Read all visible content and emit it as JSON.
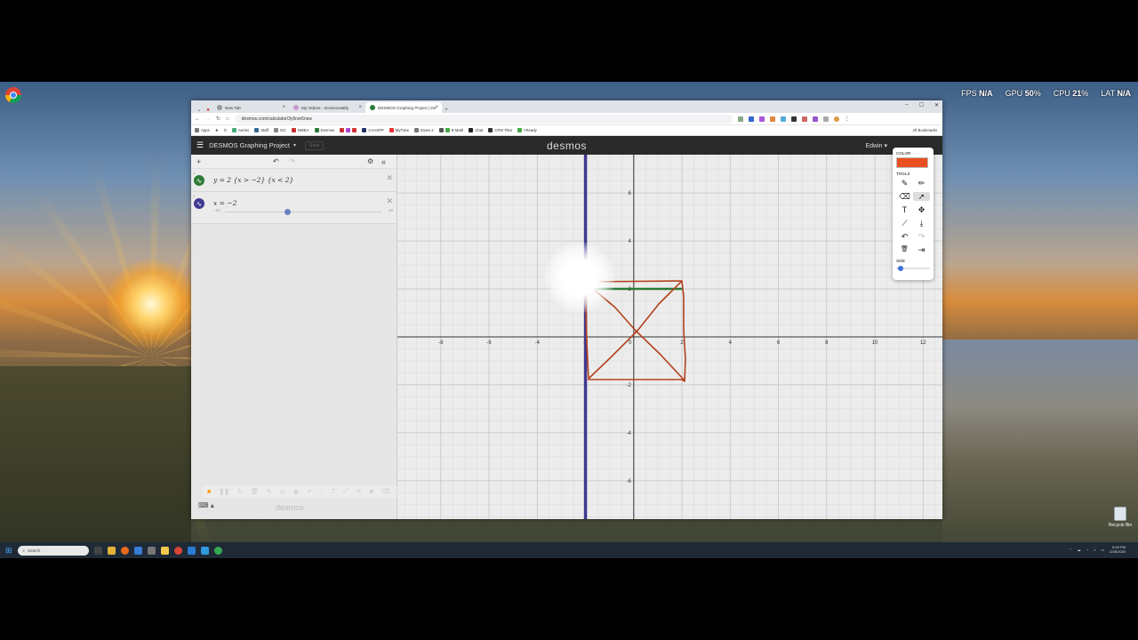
{
  "overlay": {
    "fps_label": "FPS",
    "fps_value": "N/A",
    "gpu_label": "GPU",
    "gpu_value": "50",
    "cpu_label": "CPU",
    "cpu_value": "21",
    "lat_label": "LAT",
    "lat_value": "N/A"
  },
  "desktop": {
    "recycle_bin": "Recycle Bin"
  },
  "browser": {
    "tabs": [
      {
        "label": "New Tab"
      },
      {
        "label": "My Videos - Screencastify"
      },
      {
        "label": "DESMOS Graphing Project | De"
      }
    ],
    "url": "desmos.com/calculator/3y5rze5nsw",
    "bookmarks": [
      "Apps",
      "G",
      "Aeries",
      "Staff",
      "GG",
      "NWEA",
      "Desmos",
      "CAASPP",
      "MyTube",
      "Exam 2",
      "B Math",
      "Chat",
      "CPM Tiles",
      "i-Ready"
    ],
    "all_bookmarks": "All Bookmarks"
  },
  "desmos": {
    "title": "DESMOS Graphing Project",
    "save_label": "Save",
    "logo": "desmos",
    "user": "Edwin",
    "expressions": [
      {
        "num": "1",
        "latex": "y = 2 {x > −2} {x < 2}",
        "color": "#2d7a37"
      },
      {
        "num": "2",
        "latex": "x = −2",
        "color": "#3f3891"
      }
    ],
    "slider": {
      "min": "−10",
      "max": "10",
      "value": -2
    },
    "watermark": "desmos"
  },
  "graph": {
    "x_ticks": [
      "-8",
      "-6",
      "-4",
      "-2",
      "0",
      "2",
      "4",
      "6",
      "8",
      "10",
      "12"
    ],
    "y_ticks": [
      "6",
      "4",
      "2",
      "-2",
      "-4",
      "-6"
    ],
    "x_range": [
      -9.8,
      12.8
    ],
    "y_range": [
      -7.6,
      7.6
    ]
  },
  "draw_panel": {
    "color_label": "COLOR",
    "color": "#e8501f",
    "tools_label": "TOOLS",
    "size_label": "SIZE",
    "tools": [
      "pencil-icon",
      "marker-icon",
      "eraser-icon",
      "pointer-icon",
      "text-icon",
      "move-icon",
      "line-icon",
      "download-icon",
      "undo-icon",
      "redo-icon",
      "trash-icon",
      "exit-icon"
    ],
    "tool_glyphs": [
      "✎",
      "✏",
      "⌫",
      "➚",
      "T",
      "✥",
      "⟋",
      "⤓",
      "↶",
      "↷",
      "🗑",
      "⇥"
    ]
  },
  "taskbar": {
    "search_placeholder": "Search",
    "time": "6:49 PM",
    "date": "2/26/2025"
  }
}
